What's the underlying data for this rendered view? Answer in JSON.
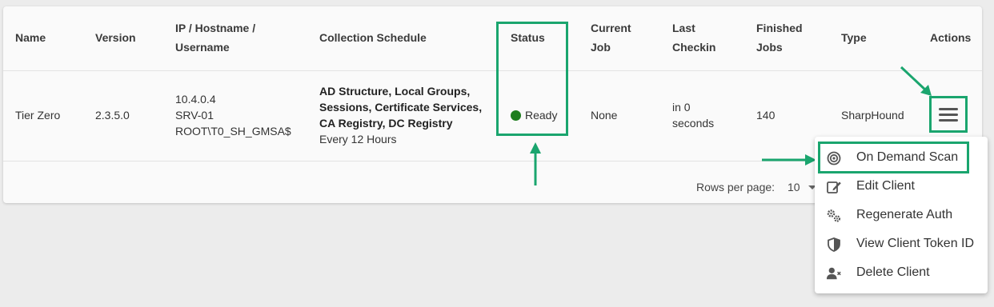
{
  "table": {
    "headers": {
      "name": "Name",
      "version": "Version",
      "ip_line1": "IP / Hostname /",
      "ip_line2": "Username",
      "schedule": "Collection Schedule",
      "status": "Status",
      "job_line1": "Current",
      "job_line2": "Job",
      "checkin_line1": "Last",
      "checkin_line2": "Checkin",
      "finished_line1": "Finished",
      "finished_line2": "Jobs",
      "type": "Type",
      "actions": "Actions"
    },
    "rows": [
      {
        "name": "Tier Zero",
        "version": "2.3.5.0",
        "ip": "10.4.0.4",
        "hostname": "SRV-01",
        "username": "ROOT\\T0_SH_GMSA$",
        "schedule_line1": "AD Structure, Local Groups,",
        "schedule_line2": "Sessions, Certificate Services,",
        "schedule_line3": "CA Registry, DC Registry",
        "schedule_freq": "Every 12 Hours",
        "status": "Ready",
        "current_job": "None",
        "checkin_line1": "in 0",
        "checkin_line2": "seconds",
        "finished_jobs": "140",
        "type": "SharpHound"
      }
    ]
  },
  "pagination": {
    "rows_per_page_label": "Rows per page:",
    "rows_per_page_value": "10"
  },
  "actions_menu": {
    "items": [
      {
        "label": "On Demand Scan",
        "icon": "target-icon"
      },
      {
        "label": "Edit Client",
        "icon": "edit-icon"
      },
      {
        "label": "Regenerate Auth",
        "icon": "gears-icon"
      },
      {
        "label": "View Client Token ID",
        "icon": "shield-icon"
      },
      {
        "label": "Delete Client",
        "icon": "user-remove-icon"
      }
    ]
  },
  "colors": {
    "highlight": "#1aa56e",
    "status_ready": "#1e7d1e"
  }
}
